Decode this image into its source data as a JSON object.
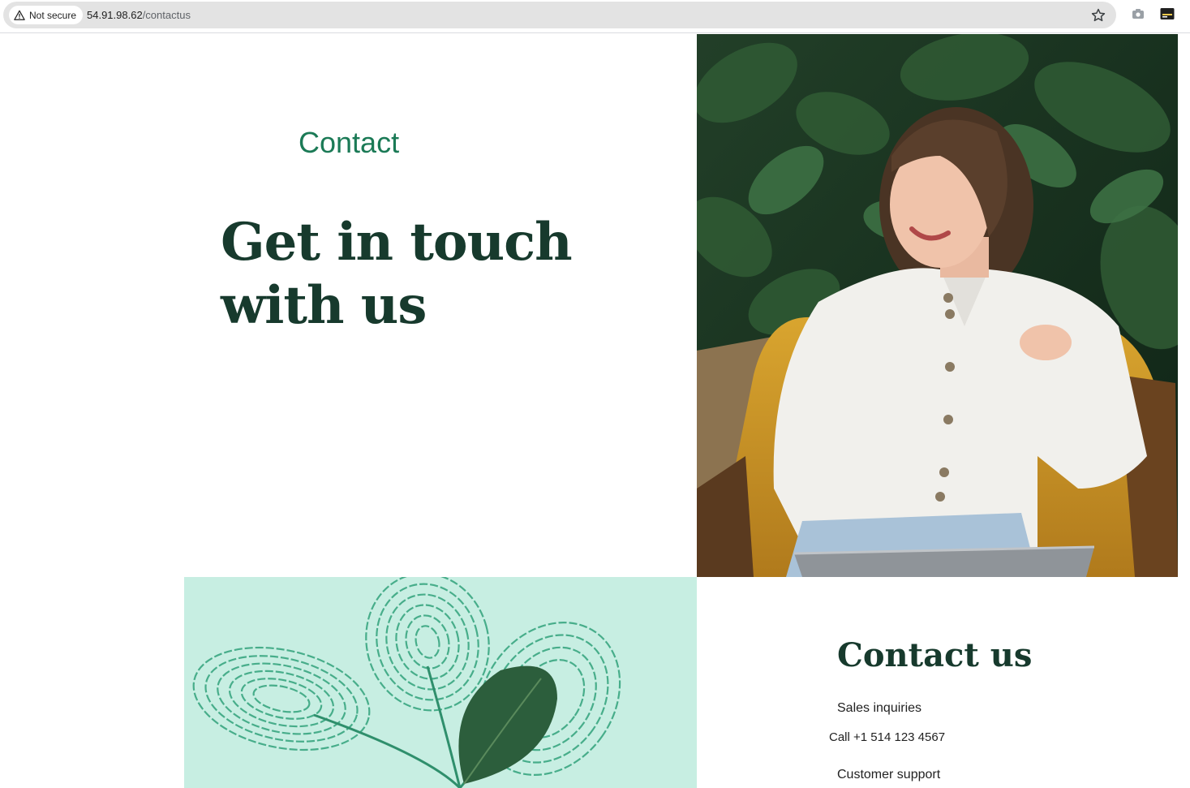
{
  "browser": {
    "security_label": "Not secure",
    "url_host": "54.91.98.62",
    "url_path": "/contactus"
  },
  "hero": {
    "eyebrow": "Contact",
    "title_line1": "Get in touch",
    "title_line2": "with us"
  },
  "contact": {
    "heading": "Contact us",
    "sales_label": "Sales inquiries",
    "phone": "Call +1 514 123 4567",
    "support_label": "Customer support"
  },
  "colors": {
    "accent_green": "#1b7a56",
    "heading_dark_green": "#173a2d",
    "leaf_panel_bg": "#c7eee2"
  },
  "icons": {
    "security": "warning-triangle-icon",
    "bookmark": "star-icon",
    "extension_1": "camera-icon",
    "extension_2": "card-icon"
  }
}
